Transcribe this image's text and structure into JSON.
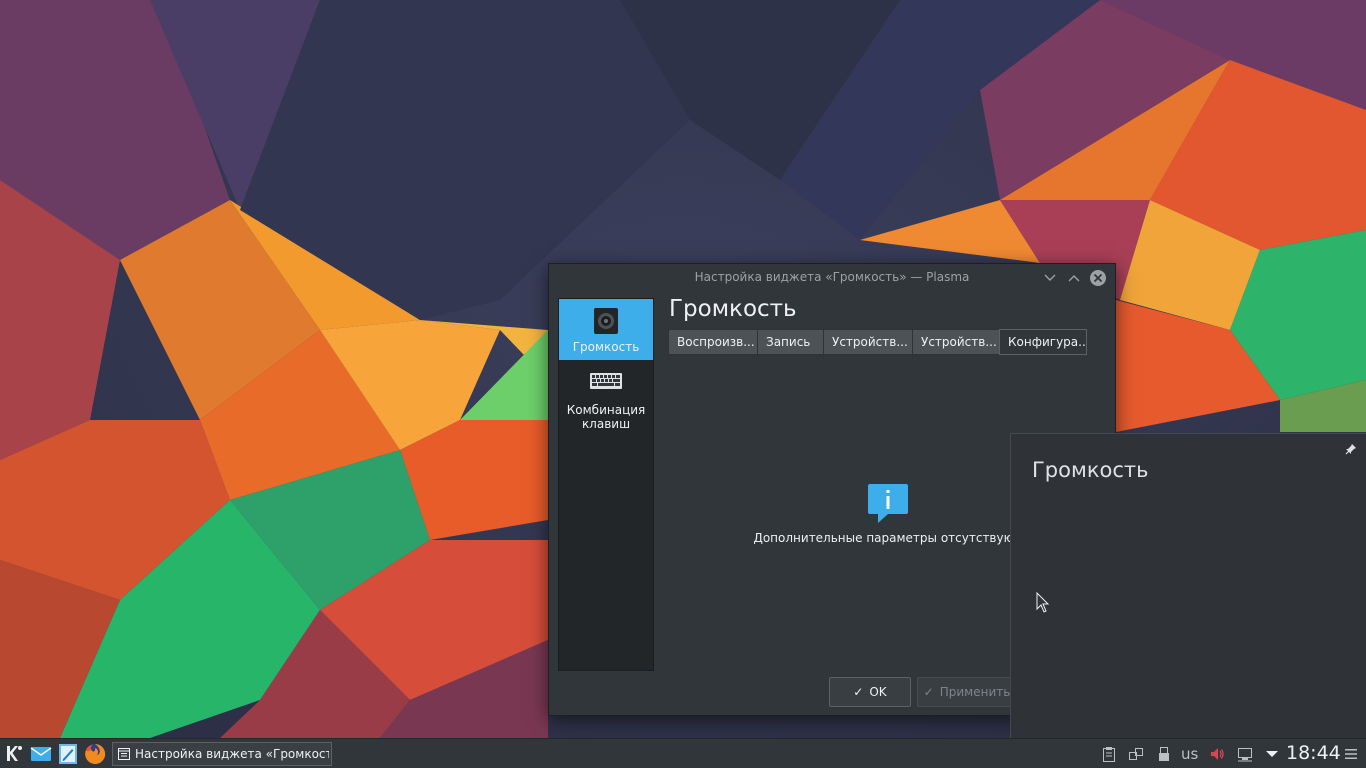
{
  "window": {
    "title": "Настройка виджета «Громкость» — Plasma",
    "page_heading": "Громкость",
    "sidebar": [
      {
        "label": "Громкость",
        "icon": "speaker-icon",
        "selected": true
      },
      {
        "label": "Комбинация клавиш",
        "icon": "keyboard-icon",
        "selected": false
      }
    ],
    "tabs": [
      {
        "label": "Воспроизв..."
      },
      {
        "label": "Запись"
      },
      {
        "label": "Устройств..."
      },
      {
        "label": "Устройств..."
      },
      {
        "label": "Конфигура...",
        "active": true
      }
    ],
    "info_message": "Дополнительные параметры отсутствуют.",
    "buttons": {
      "ok": "OK",
      "apply": "Применить"
    }
  },
  "popup": {
    "title": "Громкость"
  },
  "taskbar": {
    "task_label": "Настройка виджета «Громкость» — Plasma",
    "keyboard_layout": "us",
    "clock": "18:44"
  },
  "colors": {
    "accent": "#3daee9",
    "window_bg": "#31363b",
    "sidebar_bg": "#232629",
    "text": "#eff0f1"
  }
}
